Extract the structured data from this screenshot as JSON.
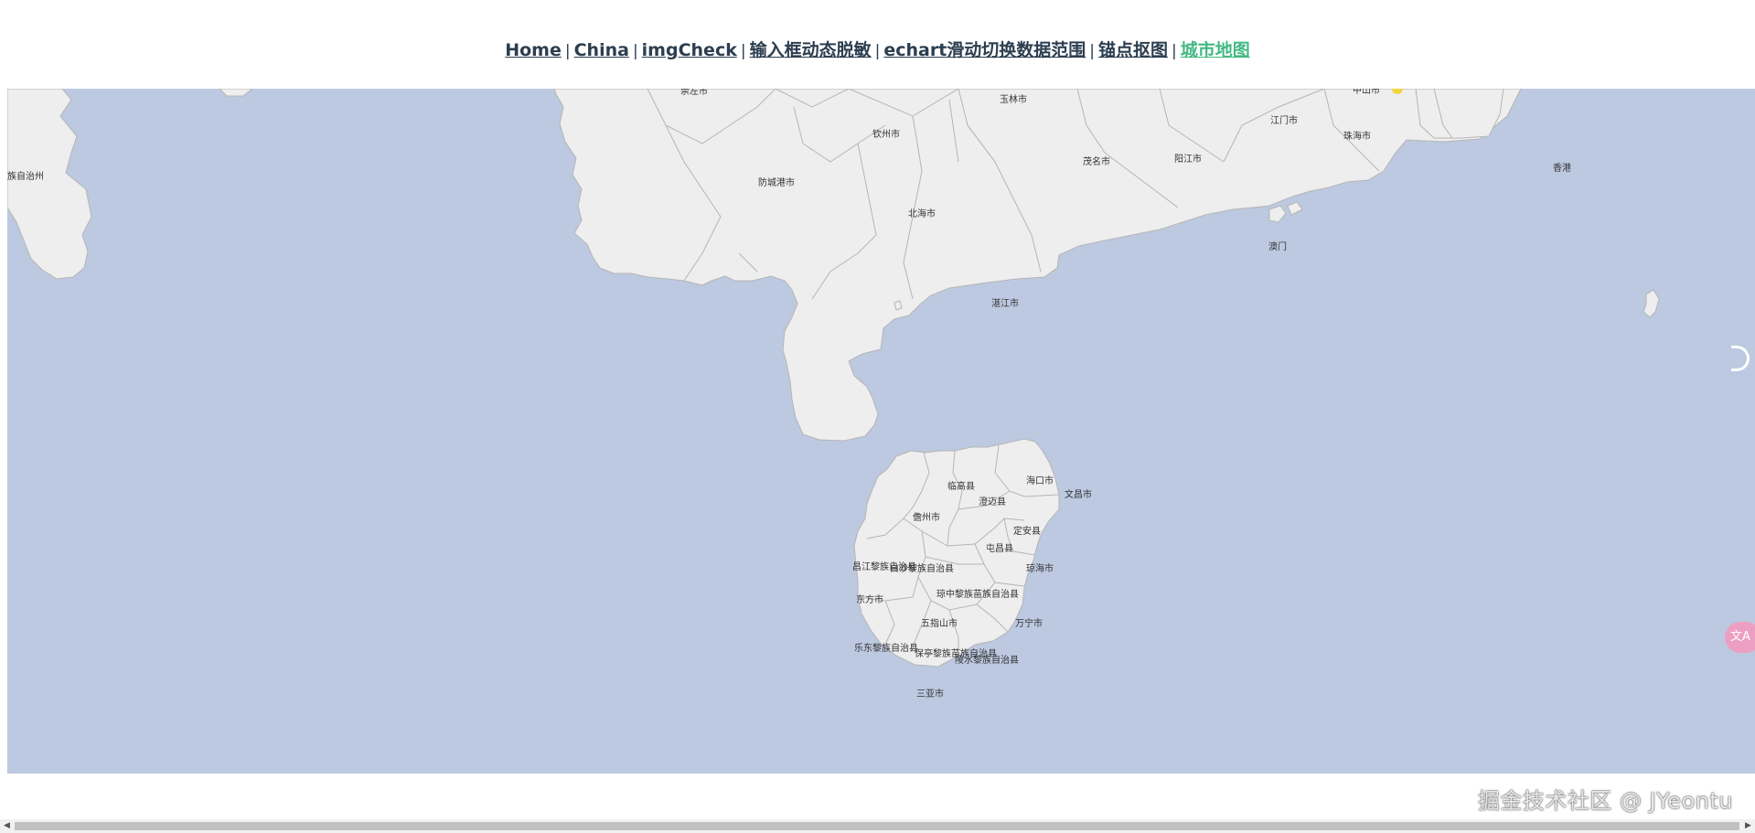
{
  "nav": {
    "links": [
      "Home",
      "China",
      "imgCheck",
      "输入框动态脱敏",
      "echart滑动切换数据范围",
      "锚点抠图",
      "城市地图"
    ],
    "separator": "|"
  },
  "map": {
    "colors": {
      "sea": "#bcc9e0",
      "land": "#eeeeee",
      "border": "#b5b5b5",
      "label": "#333333",
      "marker": "#f5d443"
    },
    "labels": {
      "chongzuo": "崇左市",
      "yulin": "玉林市",
      "zhongshan": "中山市",
      "jiangmen": "江门市",
      "zhuhai": "珠海市",
      "qinzhou": "钦州市",
      "maoming": "茂名市",
      "yangjiang": "阳江市",
      "hongkong": "香港",
      "fangchenggang": "防城港市",
      "beihai": "北海市",
      "macau": "澳门",
      "zhanjiang": "湛江市",
      "zizhizhou": "族自治州",
      "haikou": "海口市",
      "lingao": "临高县",
      "wenchang": "文昌市",
      "chengmai": "澄迈县",
      "danzhou": "儋州市",
      "dingan": "定安县",
      "tunchang": "屯昌县",
      "changjiang": "昌江黎族自治县",
      "baisha": "白沙黎族自治县",
      "qionghai": "琼海市",
      "qiongzhong": "琼中黎族苗族自治县",
      "dongfang": "东方市",
      "wuzhishan": "五指山市",
      "wanning": "万宁市",
      "ledong": "乐东黎族自治县",
      "baoting": "保亭黎族苗族自治县",
      "lingshui": "陵水黎族自治县",
      "sanya": "三亚市"
    }
  },
  "watermark": "掘金技术社区 @ JYeontu",
  "scrollbar": {
    "left_arrow": "◀",
    "right_arrow": "▶"
  },
  "translate_icon": "文A"
}
